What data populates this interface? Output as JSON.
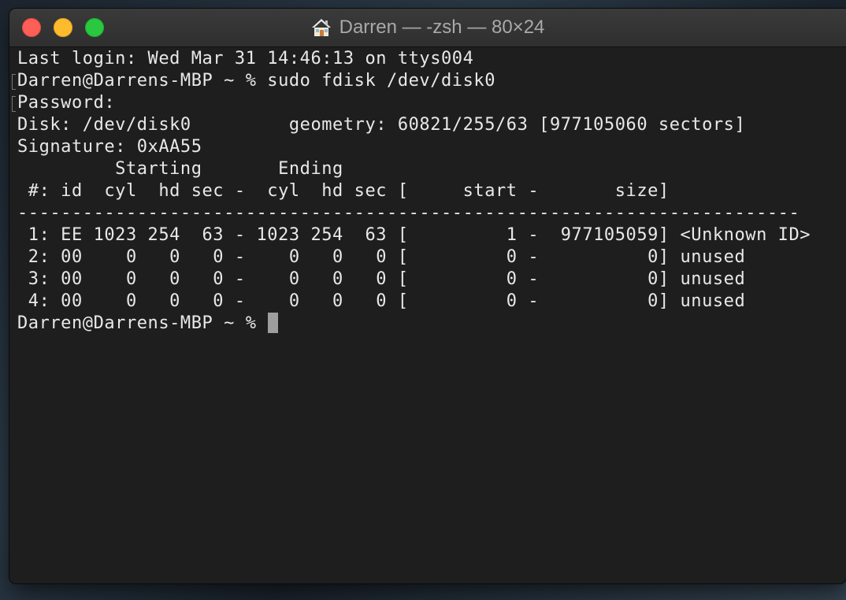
{
  "window": {
    "title": "Darren — -zsh — 80×24",
    "title_icon": "home-icon",
    "traffic_lights": {
      "close": "#fe5f57",
      "minimize": "#febb2e",
      "zoom": "#29c840"
    }
  },
  "terminal": {
    "background": "#1e1e1e",
    "foreground": "#e8e8e8",
    "lines": [
      "Last login: Wed Mar 31 14:46:13 on ttys004",
      "Darren@Darrens-MBP ~ % sudo fdisk /dev/disk0",
      "Password:",
      "Disk: /dev/disk0         geometry: 60821/255/63 [977105060 sectors]",
      "Signature: 0xAA55",
      "         Starting       Ending",
      " #: id  cyl  hd sec -  cyl  hd sec [     start -       size]",
      "------------------------------------------------------------------------",
      " 1: EE 1023 254  63 - 1023 254  63 [         1 -  977105059] <Unknown ID>",
      " 2: 00    0   0   0 -    0   0   0 [         0 -          0] unused",
      " 3: 00    0   0   0 -    0   0   0 [         0 -          0] unused",
      " 4: 00    0   0   0 -    0   0   0 [         0 -          0] unused"
    ],
    "prompt": "Darren@Darrens-MBP ~ % "
  }
}
